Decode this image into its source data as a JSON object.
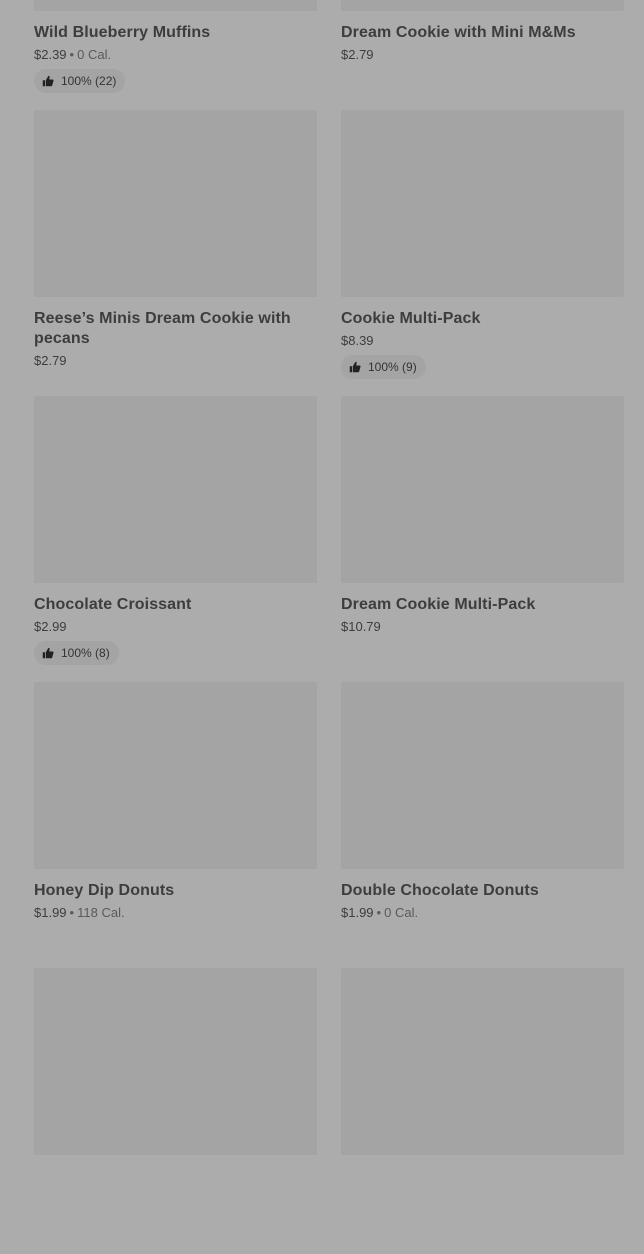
{
  "items": [
    {
      "name": "Wild Blueberry Muffins",
      "price": "$2.39",
      "separator": "•",
      "calories": "0 Cal.",
      "rating": "100% (22)"
    },
    {
      "name": "Dream Cookie with Mini M&Ms",
      "price": "$2.79"
    },
    {
      "name": "Reese’s Minis Dream Cookie with pecans",
      "price": "$2.79"
    },
    {
      "name": "Cookie Multi-Pack",
      "price": "$8.39",
      "rating": "100% (9)"
    },
    {
      "name": "Chocolate Croissant",
      "price": "$2.99",
      "rating": "100% (8)"
    },
    {
      "name": "Dream Cookie Multi-Pack",
      "price": "$10.79"
    },
    {
      "name": "Honey Dip Donuts",
      "price": "$1.99",
      "separator": "•",
      "calories": "118 Cal."
    },
    {
      "name": "Double Chocolate Donuts",
      "price": "$1.99",
      "separator": "•",
      "calories": "0 Cal."
    }
  ],
  "icons": {
    "rating": "thumbs-up-icon"
  },
  "colors": {
    "background": "#acacac",
    "placeholder": "#a4a4a4",
    "text": "#3d3d3d"
  }
}
